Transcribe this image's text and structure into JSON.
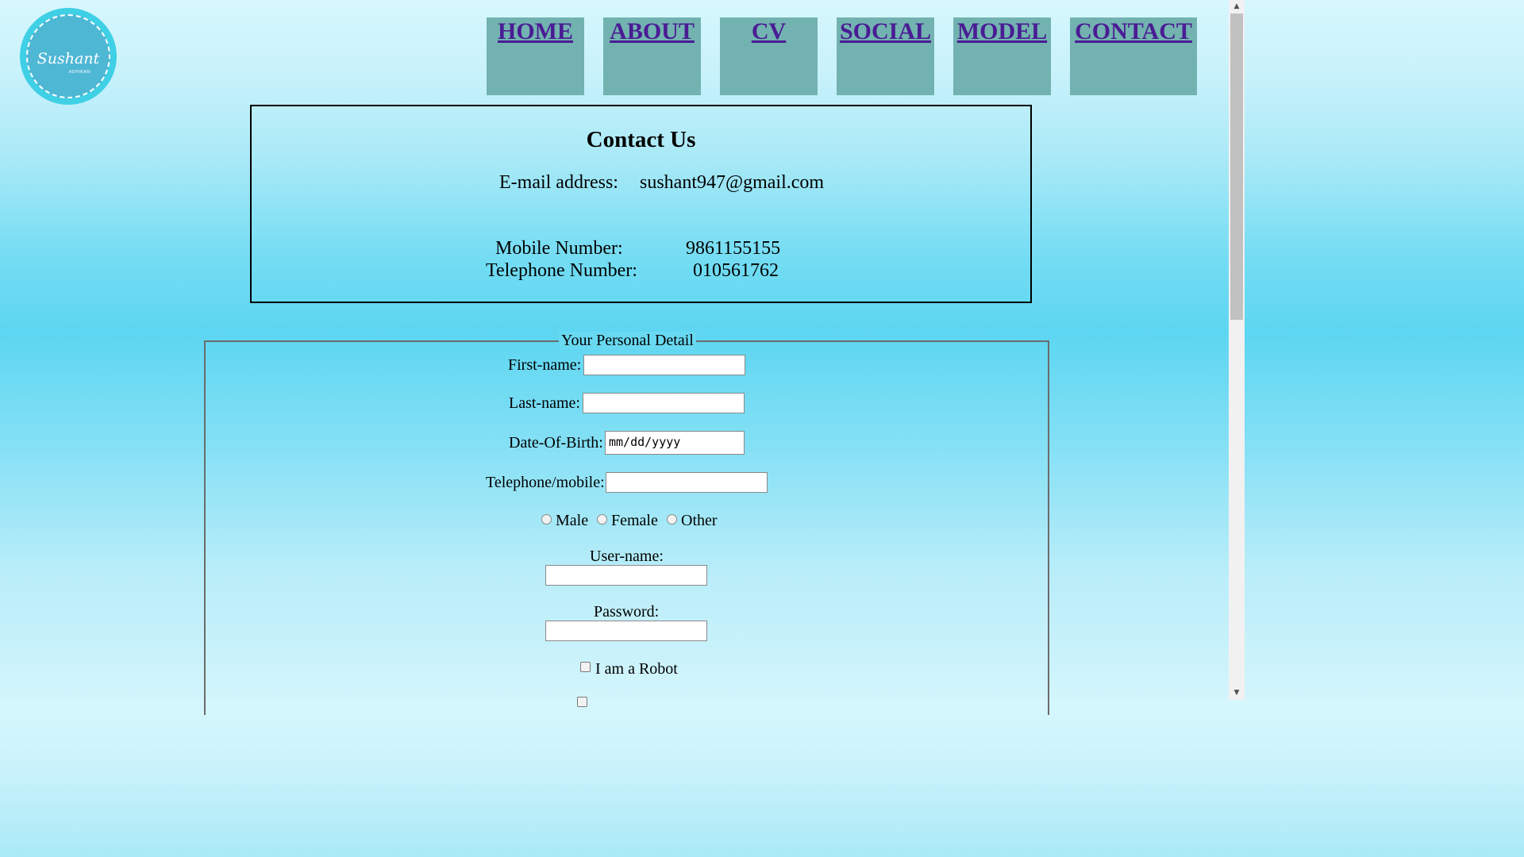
{
  "logo": {
    "script_text": "Sushant",
    "sub_text": "ADHIKARI"
  },
  "nav": {
    "items": [
      {
        "label": "HOME"
      },
      {
        "label": "ABOUT"
      },
      {
        "label": "CV"
      },
      {
        "label": "SOCIAL"
      },
      {
        "label": "MODEL"
      },
      {
        "label": "CONTACT"
      }
    ]
  },
  "contact": {
    "title": "Contact Us",
    "email_label": "E-mail address:",
    "email_value": "sushant947@gmail.com",
    "mobile_label": "Mobile Number:",
    "mobile_value": "9861155155",
    "telephone_label": "Telephone Number:",
    "telephone_value": "010561762"
  },
  "form": {
    "legend": "Your Personal Detail",
    "first_name_label": "First-name:",
    "first_name_value": "",
    "last_name_label": "Last-name:",
    "last_name_value": "",
    "dob_label": "Date-Of-Birth:",
    "dob_placeholder": "mm/dd/yyyy",
    "phone_label": "Telephone/mobile:",
    "phone_value": "",
    "gender_options": [
      "Male",
      "Female",
      "Other"
    ],
    "username_label": "User-name:",
    "username_value": "",
    "password_label": "Password:",
    "password_value": "",
    "robot_label": "I am a Robot"
  },
  "colors": {
    "nav_bg": "#72b2b0",
    "nav_link": "#4a1c94",
    "logo_bg": "#3fd0e6"
  }
}
